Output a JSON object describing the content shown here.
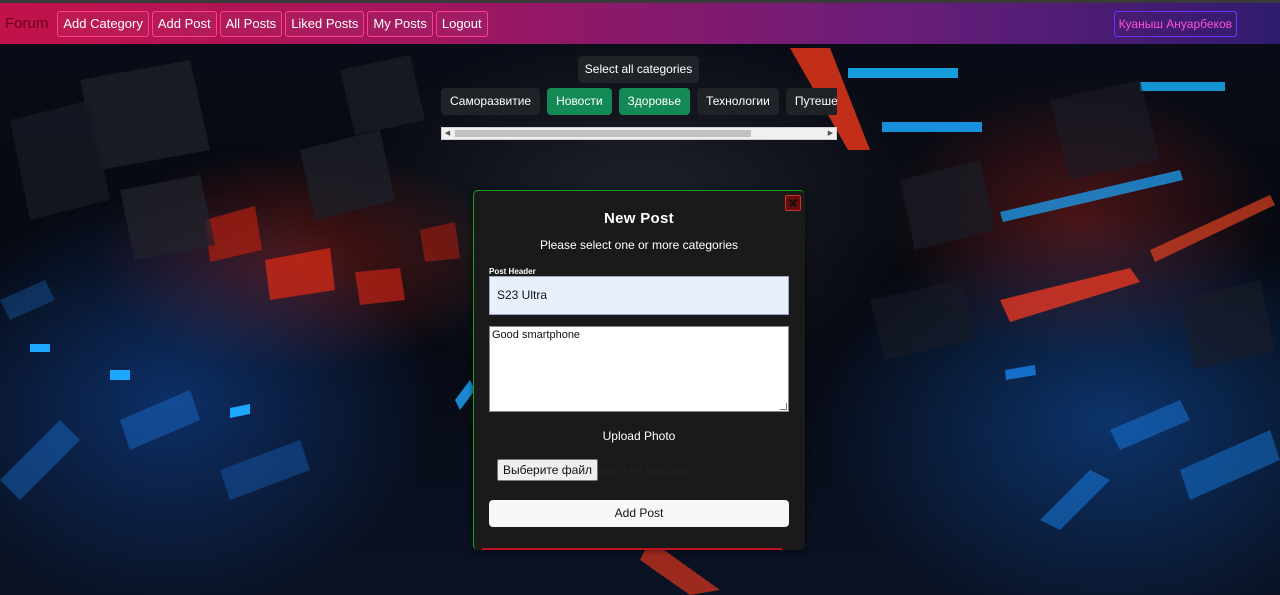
{
  "navbar": {
    "brand": "Forum",
    "items": [
      {
        "label": "Add Category"
      },
      {
        "label": "Add Post"
      },
      {
        "label": "All Posts"
      },
      {
        "label": "Liked Posts"
      },
      {
        "label": "My Posts"
      },
      {
        "label": "Logout"
      }
    ],
    "user": "Куаныш Ануарбеков"
  },
  "categories": {
    "select_all": "Select all categories",
    "items": [
      {
        "label": "Саморазвитие",
        "selected": false
      },
      {
        "label": "Новости",
        "selected": true
      },
      {
        "label": "Здоровье",
        "selected": true
      },
      {
        "label": "Технологии",
        "selected": false
      },
      {
        "label": "Путешествия",
        "selected": false
      }
    ]
  },
  "modal": {
    "title": "New Post",
    "subtitle": "Please select one or more categories",
    "header_label": "Post Header",
    "header_value": "S23 Ultra",
    "body_value": "Good smartphone",
    "upload_label": "Upload Photo",
    "file_button": "Выберите файл",
    "file_status": "Файл не выбран",
    "submit": "Add Post"
  },
  "colors": {
    "nav_start": "#c2124a",
    "nav_end": "#2f1c6e",
    "category_active": "#138a56",
    "modal_bg": "#1a1a1a"
  }
}
